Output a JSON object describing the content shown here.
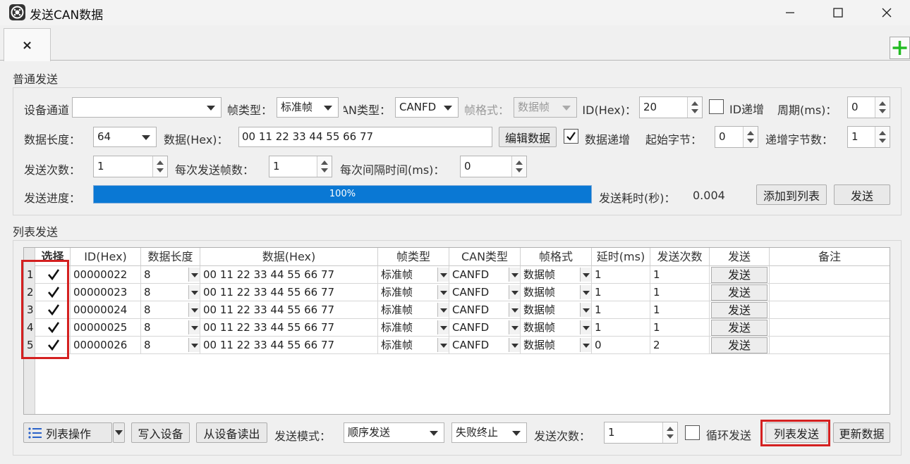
{
  "window": {
    "title": "发送CAN数据",
    "tab_close": "×",
    "add_tab": "+"
  },
  "normal": {
    "section_label": "普通发送",
    "device_channel_label": "设备通道",
    "device_channel_value": "",
    "frame_type_label": "帧类型：",
    "frame_type_value": "标准帧",
    "can_type_label": "CAN类型：",
    "can_type_value": "CANFD",
    "frame_format_label": "帧格式：",
    "frame_format_value": "数据帧",
    "id_label": "ID(Hex)：",
    "id_value": "20",
    "id_increment_label": "ID递增",
    "period_label": "周期(ms)：",
    "period_value": "0",
    "data_length_label": "数据长度：",
    "data_length_value": "64",
    "data_hex_label": "数据(Hex)：",
    "data_hex_value": "00 11 22 33 44 55 66 77",
    "edit_data_button": "编辑数据",
    "data_increment_label": "数据递增",
    "start_byte_label": "起始字节：",
    "start_byte_value": "0",
    "increment_bytes_label": "递增字节数：",
    "increment_bytes_value": "1",
    "send_count_label": "发送次数：",
    "send_count_value": "1",
    "frames_per_send_label": "每次发送帧数：",
    "frames_per_send_value": "1",
    "interval_label": "每次间隔时间(ms)：",
    "interval_value": "0",
    "progress_label": "发送进度：",
    "progress_text": "100%",
    "progress_fraction": 1.0,
    "elapsed_label": "发送耗时(秒)：",
    "elapsed_value": "0.004",
    "add_to_list_button": "添加到列表",
    "send_button": "发送"
  },
  "list": {
    "section_label": "列表发送",
    "columns": [
      "选择",
      "ID(Hex)",
      "数据长度",
      "数据(Hex)",
      "帧类型",
      "CAN类型",
      "帧格式",
      "延时(ms)",
      "发送次数",
      "发送",
      "备注"
    ],
    "rows": [
      {
        "no": "1",
        "id": "00000022",
        "len": "8",
        "data": "00 11 22 33 44 55 66 77",
        "frame_type": "标准帧",
        "can_type": "CANFD",
        "frame_format": "数据帧",
        "delay": "1",
        "count": "1",
        "send": "发送",
        "note": ""
      },
      {
        "no": "2",
        "id": "00000023",
        "len": "8",
        "data": "00 11 22 33 44 55 66 77",
        "frame_type": "标准帧",
        "can_type": "CANFD",
        "frame_format": "数据帧",
        "delay": "1",
        "count": "1",
        "send": "发送",
        "note": ""
      },
      {
        "no": "3",
        "id": "00000024",
        "len": "8",
        "data": "00 11 22 33 44 55 66 77",
        "frame_type": "标准帧",
        "can_type": "CANFD",
        "frame_format": "数据帧",
        "delay": "1",
        "count": "1",
        "send": "发送",
        "note": ""
      },
      {
        "no": "4",
        "id": "00000025",
        "len": "8",
        "data": "00 11 22 33 44 55 66 77",
        "frame_type": "标准帧",
        "can_type": "CANFD",
        "frame_format": "数据帧",
        "delay": "1",
        "count": "1",
        "send": "发送",
        "note": ""
      },
      {
        "no": "5",
        "id": "00000026",
        "len": "8",
        "data": "00 11 22 33 44 55 66 77",
        "frame_type": "标准帧",
        "can_type": "CANFD",
        "frame_format": "数据帧",
        "delay": "0",
        "count": "2",
        "send": "发送",
        "note": ""
      }
    ]
  },
  "bottom": {
    "list_ops_button": "列表操作",
    "write_device_button": "写入设备",
    "read_device_button": "从设备读出",
    "send_mode_label": "发送模式：",
    "send_mode_value": "顺序发送",
    "fail_mode_value": "失败终止",
    "send_count_label": "发送次数：",
    "send_count_value": "1",
    "loop_label": "循环发送",
    "list_send_button": "列表发送",
    "update_data_button": "更新数据"
  },
  "colors": {
    "accent": "#0a78d4",
    "highlight": "#d42020",
    "add_icon": "#22bb22"
  }
}
